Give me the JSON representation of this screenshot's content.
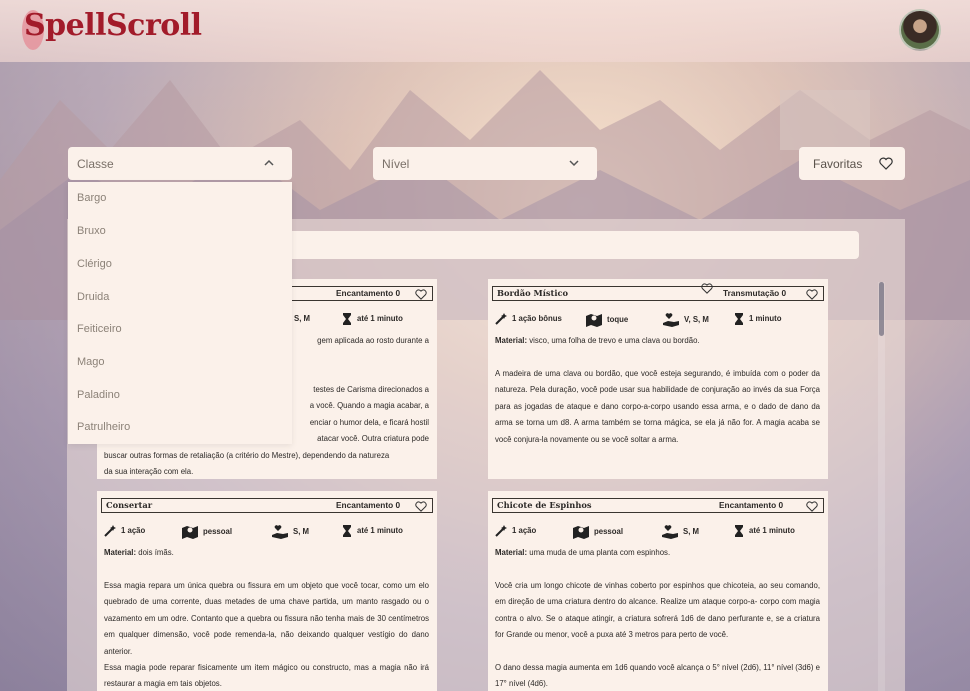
{
  "app": {
    "logo": "SpellScroll"
  },
  "filters": {
    "classe_placeholder": "Classe",
    "nivel_placeholder": "Nível",
    "favoritas_label": "Favoritas"
  },
  "classe_options": [
    "Bargo",
    "Bruxo",
    "Clérigo",
    "Druida",
    "Feiticeiro",
    "Mago",
    "Paladino",
    "Patrulheiro"
  ],
  "cards": [
    {
      "name": "",
      "school": "Encantamento 0",
      "components": "S, M",
      "duration": "até 1 minuto",
      "text_lines": [
        "gem aplicada ao rosto durante a",
        "testes de Carisma direcionados a",
        "a você. Quando a magia acabar, a",
        "enciar o humor dela, e ficará hostil",
        "atacar você. Outra criatura pode",
        "buscar outras formas de retaliação (a critério do Mestre), dependendo da natureza",
        "da sua interação com ela."
      ]
    },
    {
      "name": "Bordão Místico",
      "school": "Transmutação 0",
      "casting": "1 ação bônus",
      "range": "toque",
      "components": "V, S, M",
      "duration": "1 minuto",
      "material_label": "Material:",
      "material": "visco, uma folha de trevo e uma clava ou bordão.",
      "description": "A madeira de uma clava ou bordão, que você esteja segurando, é imbuída com o poder da natureza. Pela duração, você pode usar sua habilidade de conjuração ao invés da sua Força para as jogadas de ataque e dano corpo-a-corpo usando essa arma, e o dado de dano da arma se torna um d8. A arma também se torna mágica, se ela já não for. A magia acaba se você conjura-la novamente ou se você soltar a arma."
    },
    {
      "name": "Consertar",
      "school": "Encantamento 0",
      "casting": "1 ação",
      "range": "pessoal",
      "components": "S, M",
      "duration": "até 1 minuto",
      "material_label": "Material:",
      "material": "dois ímãs.",
      "description": "Essa magia repara um única quebra ou fissura em um objeto que você tocar, como um elo quebrado de uma corrente, duas metades de uma chave partida, um manto rasgado ou o vazamento em um odre. Contanto que a quebra ou fissura não tenha mais de 30 centímetros em qualquer dimensão, você pode remenda-la, não deixando qualquer vestígio do dano anterior.",
      "description2": "Essa magia pode reparar fisicamente um item mágico ou constructo, mas a magia não irá restaurar a magia em tais objetos."
    },
    {
      "name": "Chicote de Espinhos",
      "school": "Encantamento 0",
      "casting": "1 ação",
      "range": "pessoal",
      "components": "S, M",
      "duration": "até 1 minuto",
      "material_label": "Material:",
      "material": "uma muda de uma planta com espinhos.",
      "description": "Você cria um longo chicote de vinhas coberto por espinhos que chicoteia, ao seu comando, em direção de uma criatura dentro do alcance. Realize um ataque corpo-a- corpo com magia contra o alvo. Se o ataque atingir, a criatura sofrerá 1d6 de dano perfurante e, se a criatura for Grande ou menor, você a puxa até 3 metros para perto de você.",
      "description2": "O dano dessa magia aumenta em 1d6 quando você alcança o 5° nível (2d6), 11° nível (3d6) e 17° nível (4d6)."
    }
  ]
}
